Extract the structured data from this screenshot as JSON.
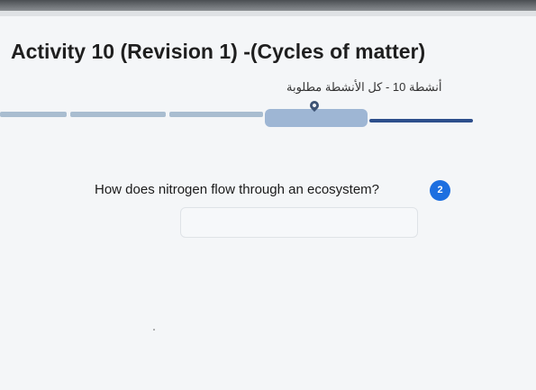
{
  "header": {
    "title": "Activity 10 (Revision 1) -(Cycles of matter)",
    "subtitle": "أنشطة 10 - كل الأنشطة مطلوبة"
  },
  "progress": {
    "segments": 5,
    "current_segment": 4
  },
  "question": {
    "text": "How does nitrogen flow through an ecosystem?",
    "number": "2",
    "answer_value": ""
  },
  "icons": {
    "location": "map-pin-icon"
  },
  "colors": {
    "badge": "#1d6fe0",
    "progress_done": "#a9bdd0",
    "progress_remaining": "#2d4f8c"
  }
}
